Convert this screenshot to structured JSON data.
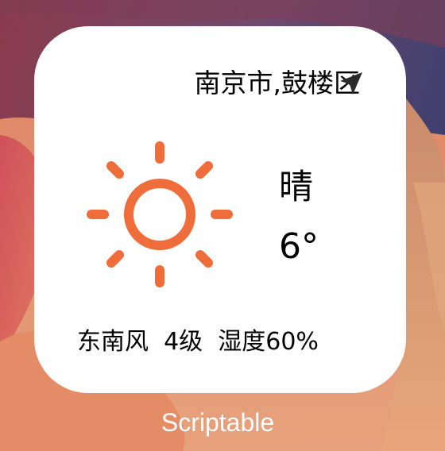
{
  "widget": {
    "location": "南京市,鼓楼区",
    "location_icon": "location-arrow-icon",
    "weather_icon": "sun-icon",
    "condition": "晴",
    "temperature": "6°",
    "wind_humidity": "东南风  4级  湿度60%"
  },
  "app_label": "Scriptable",
  "colors": {
    "sun": "#EE6D3B",
    "widget_bg": "#FFFFFF",
    "text": "#000000",
    "label": "#FFFFFF"
  }
}
